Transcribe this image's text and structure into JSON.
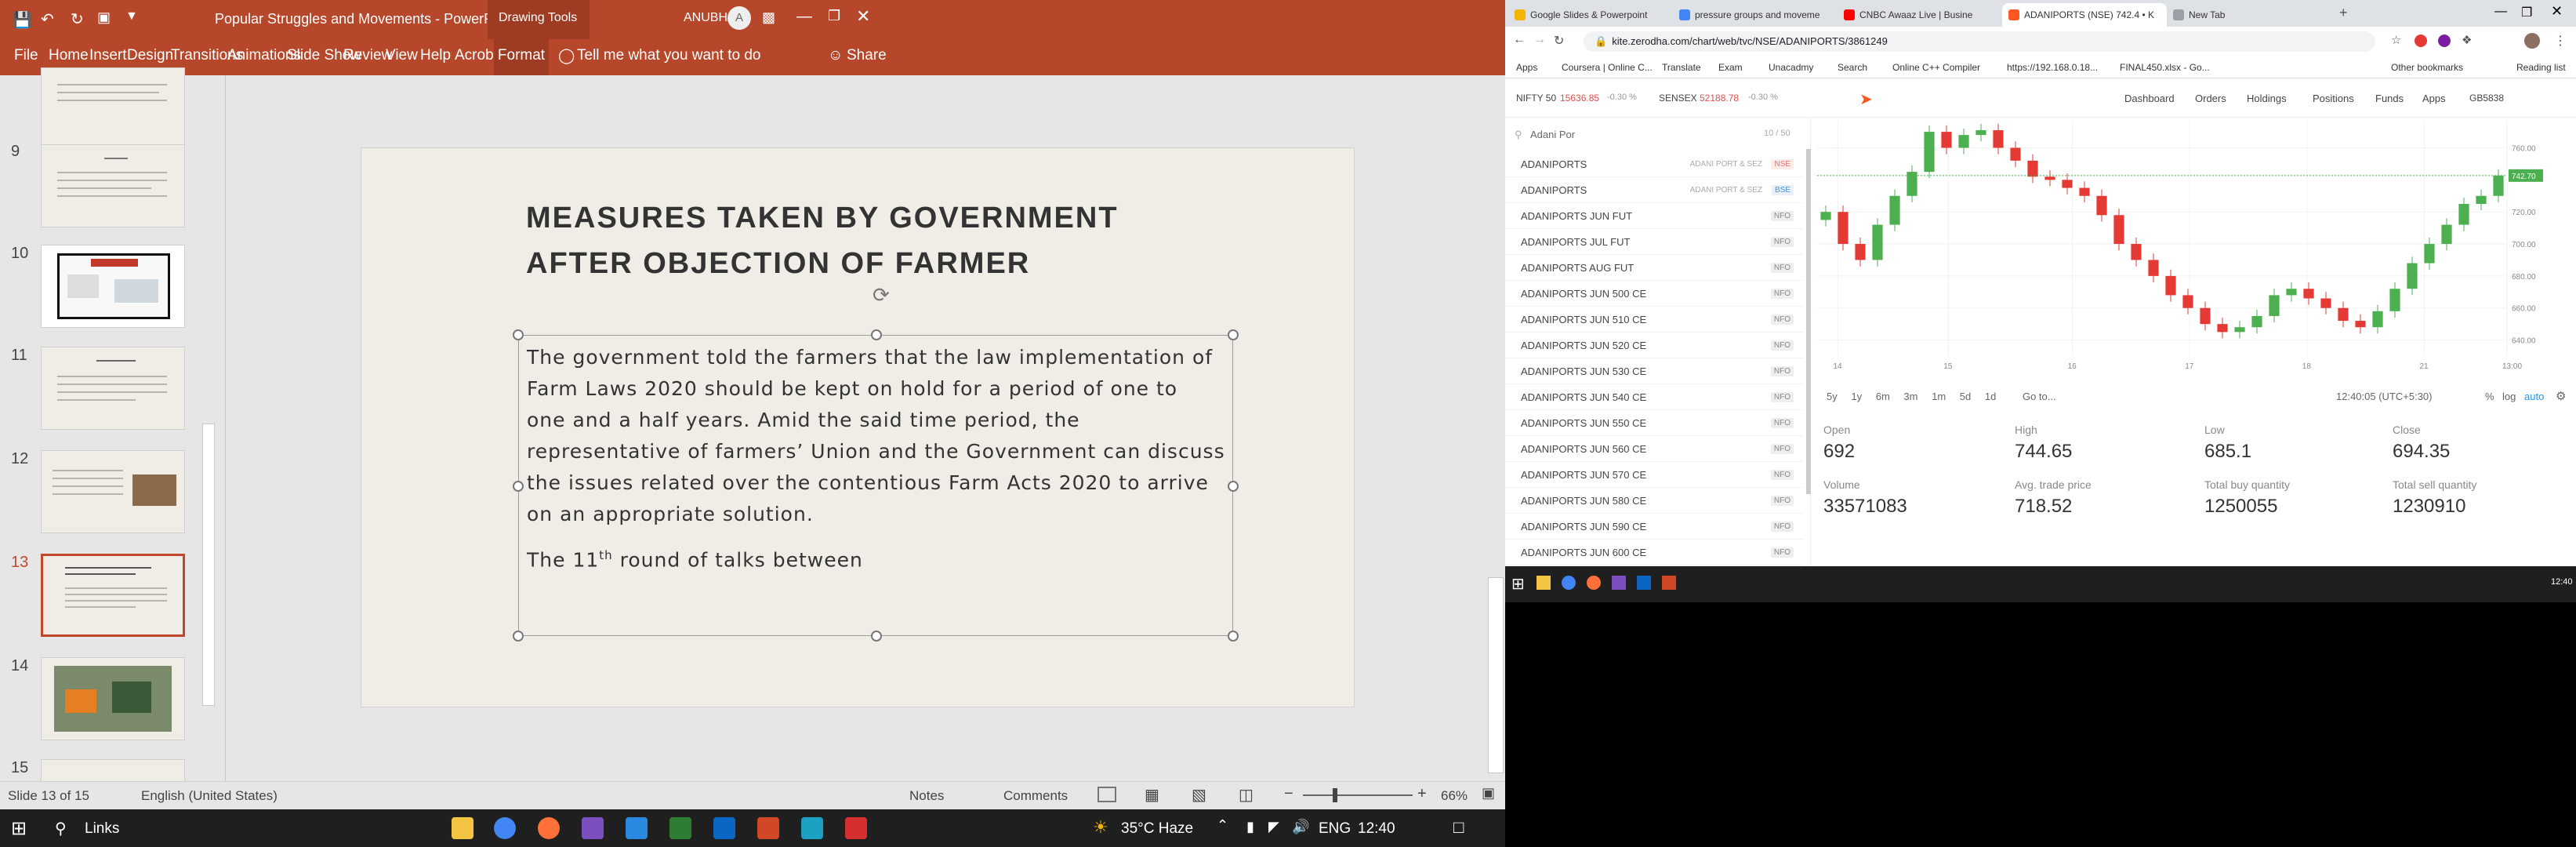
{
  "ppt": {
    "title": "Popular Struggles and Movements  -  PowerPoint",
    "drawing_tools": "Drawing Tools",
    "user": "ANUBHAV",
    "avatar_letter": "A",
    "tabs": [
      "File",
      "Home",
      "Insert",
      "Design",
      "Transitions",
      "Animations",
      "Slide Show",
      "Review",
      "View",
      "Help",
      "Acrobat",
      "Format"
    ],
    "tell_me": "Tell me what you want to do",
    "share": "Share",
    "thumb_numbers": [
      "9",
      "10",
      "11",
      "12",
      "13",
      "14",
      "15"
    ],
    "slide": {
      "title_line1": "MEASURES TAKEN BY GOVERNMENT",
      "title_line2": "AFTER OBJECTION OF FARMER",
      "para1_l1": "The government told the farmers that the law implementation of",
      "para1_l2": "Farm Laws 2020 should be kept on hold for a period of one to",
      "para1_l3": "one and a half years. Amid the said time period, the",
      "para1_l4": "representative of farmers’ Union and the Government can discuss",
      "para1_l5": "the issues related over the contentious Farm Acts 2020 to arrive",
      "para1_l6": "on an appropriate solution.",
      "para2_a": "The 11",
      "para2_sup": "th",
      "para2_b": " round of talks between"
    },
    "status": {
      "slide_of": "Slide 13 of 15",
      "language": "English (United States)",
      "notes": "Notes",
      "comments": "Comments",
      "zoom": "66%"
    }
  },
  "taskbar": {
    "search": "Links",
    "weather": "35°C  Haze",
    "lang": "ENG",
    "time": "12:40"
  },
  "chrome": {
    "tabs": [
      {
        "title": "Google Slides & Powerpoint",
        "color": "#f4b400"
      },
      {
        "title": "pressure groups and moveme",
        "color": "#4285f4"
      },
      {
        "title": "CNBC Awaaz Live | Busine",
        "color": "#ff0000"
      },
      {
        "title": "ADANIPORTS (NSE) 742.4 • K",
        "color": "#ff5722"
      },
      {
        "title": "New Tab",
        "color": "#9aa0a6"
      }
    ],
    "url": "kite.zerodha.com/chart/web/tvc/NSE/ADANIPORTS/3861249",
    "bookmarks": [
      "Apps",
      "Coursera | Online C...",
      "Translate",
      "Exam",
      "Unacadmy",
      "Search",
      "Online C++ Compiler",
      "https://192.168.0.18...",
      "FINAL450.xlsx - Go...",
      "Other bookmarks",
      "Reading list"
    ]
  },
  "kite": {
    "nifty_label": "NIFTY 50",
    "nifty_value": "15636.85",
    "nifty_change": "-0.30 %",
    "sensex_label": "SENSEX",
    "sensex_value": "52188.78",
    "sensex_change": "-0.30 %",
    "nav": [
      "Dashboard",
      "Orders",
      "Holdings",
      "Positions",
      "Funds",
      "Apps"
    ],
    "user_id": "GB5838",
    "search_value": "Adani Por",
    "search_count": "10 / 50",
    "watchlist": [
      {
        "name": "ADANIPORTS",
        "tag": "ADANI PORT & SEZ",
        "badge": "NSE"
      },
      {
        "name": "ADANIPORTS",
        "tag": "ADANI PORT & SEZ",
        "badge": "BSE"
      },
      {
        "name": "ADANIPORTS JUN FUT",
        "tag": "",
        "badge": "NFO"
      },
      {
        "name": "ADANIPORTS JUL FUT",
        "tag": "",
        "badge": "NFO"
      },
      {
        "name": "ADANIPORTS AUG FUT",
        "tag": "",
        "badge": "NFO"
      },
      {
        "name": "ADANIPORTS JUN 500 CE",
        "tag": "",
        "badge": "NFO"
      },
      {
        "name": "ADANIPORTS JUN 510 CE",
        "tag": "",
        "badge": "NFO"
      },
      {
        "name": "ADANIPORTS JUN 520 CE",
        "tag": "",
        "badge": "NFO"
      },
      {
        "name": "ADANIPORTS JUN 530 CE",
        "tag": "",
        "badge": "NFO"
      },
      {
        "name": "ADANIPORTS JUN 540 CE",
        "tag": "",
        "badge": "NFO"
      },
      {
        "name": "ADANIPORTS JUN 550 CE",
        "tag": "",
        "badge": "NFO"
      },
      {
        "name": "ADANIPORTS JUN 560 CE",
        "tag": "",
        "badge": "NFO"
      },
      {
        "name": "ADANIPORTS JUN 570 CE",
        "tag": "",
        "badge": "NFO"
      },
      {
        "name": "ADANIPORTS JUN 580 CE",
        "tag": "",
        "badge": "NFO"
      },
      {
        "name": "ADANIPORTS JUN 590 CE",
        "tag": "",
        "badge": "NFO"
      },
      {
        "name": "ADANIPORTS JUN 600 CE",
        "tag": "",
        "badge": "NFO"
      }
    ],
    "chart_ranges": [
      "5y",
      "1y",
      "6m",
      "3m",
      "1m",
      "5d",
      "1d",
      "Go to..."
    ],
    "chart_time": "12:40:05 (UTC+5:30)",
    "chart_opts": [
      "%",
      "log",
      "auto"
    ],
    "x_ticks": [
      "14",
      "15",
      "16",
      "17",
      "18",
      "21",
      "13:00"
    ],
    "y_ticks": [
      "760.00",
      "742.70",
      "720.00",
      "700.00",
      "680.00",
      "660.00",
      "640.00"
    ],
    "last_price": "742.70",
    "ohlc": [
      {
        "label": "Open",
        "value": "692"
      },
      {
        "label": "High",
        "value": "744.65"
      },
      {
        "label": "Low",
        "value": "685.1"
      },
      {
        "label": "Close",
        "value": "694.35"
      }
    ],
    "stats": [
      {
        "label": "Volume",
        "value": "33571083"
      },
      {
        "label": "Avg. trade price",
        "value": "718.52"
      },
      {
        "label": "Total buy quantity",
        "value": "1250055"
      },
      {
        "label": "Total sell quantity",
        "value": "1230910"
      }
    ],
    "tray_time": "12:40"
  }
}
